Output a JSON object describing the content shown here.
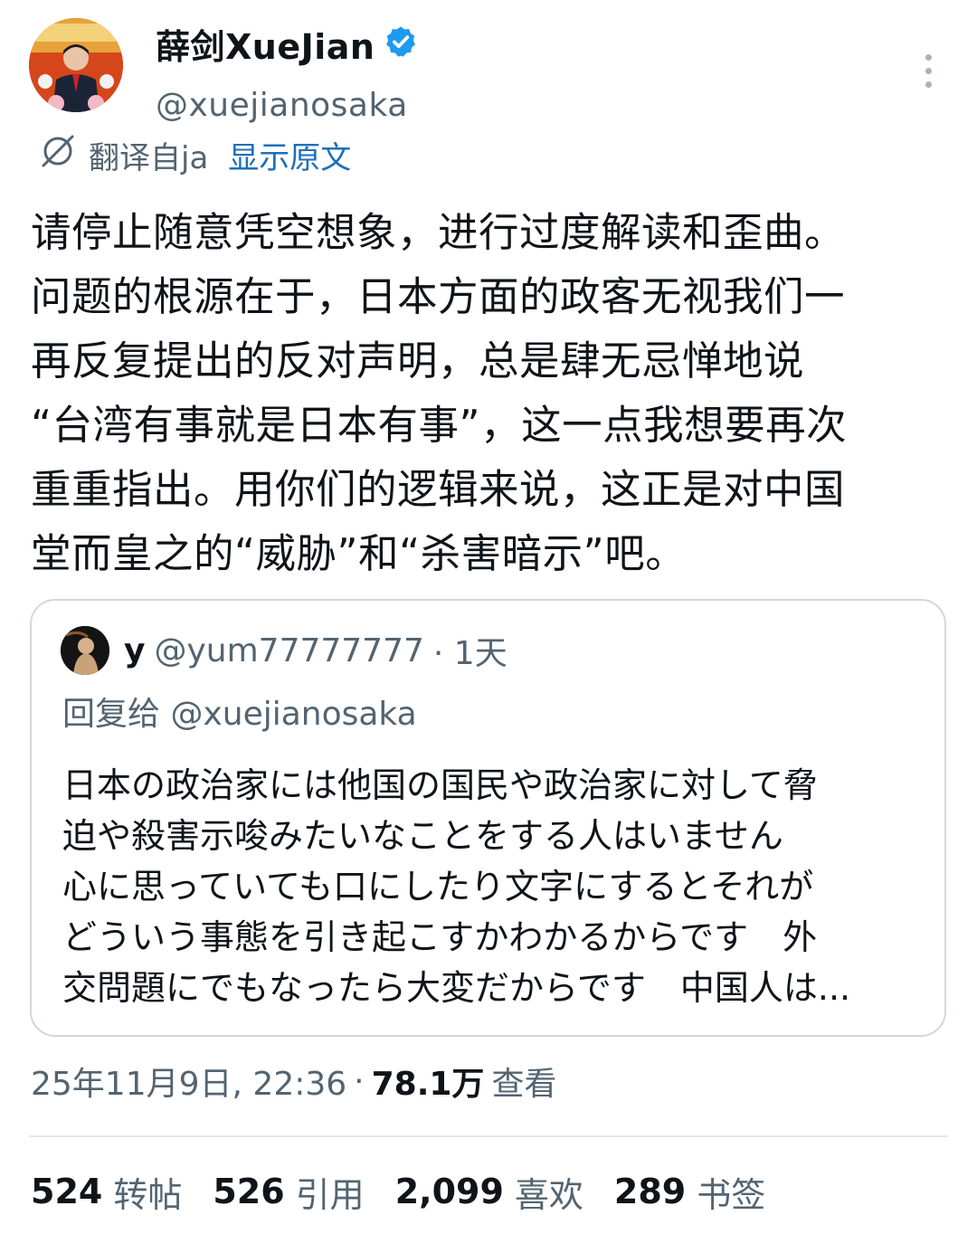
{
  "author": {
    "display_name": "薛剑XueJian",
    "handle": "@xuejianosaka",
    "verified_icon": "verified-badge-icon",
    "brand_color": "#1d9bf0"
  },
  "translation": {
    "label": "翻译自ja",
    "show_original": "显示原文"
  },
  "tweet": {
    "text": "请停止随意凭空想象，进行过度解读和歪曲。\n问题的根源在于，日本方面的政客无视我们一\n再反复提出的反对声明，总是肆无忌惮地说\n“台湾有事就是日本有事”，这一点我想要再次\n重重指出。用你们的逻辑来说，这正是对中国\n堂而皇之的“威胁”和“杀害暗示”吧。"
  },
  "quote": {
    "name": "y",
    "handle": "@yum77777777",
    "time": "· 1天",
    "reply_to": "回复给 @xuejianosaka",
    "text": "日本の政治家には他国の国民や政治家に対して脅\n迫や殺害示唆みたいなことをする人はいません\n心に思っていても口にしたり文字にするとそれが\nどういう事態を引き起こすかわかるからです　外\n交問題にでもなったら大変だからです　中国人は..."
  },
  "meta": {
    "timestamp": "25年11月9日, 22:36",
    "separator": "·",
    "views_count": "78.1万",
    "views_label": "查看"
  },
  "stats": {
    "reposts_count": "524",
    "reposts_label": "转帖",
    "quotes_count": "526",
    "quotes_label": "引用",
    "likes_count": "2,099",
    "likes_label": "喜欢",
    "bookmarks_count": "289",
    "bookmarks_label": "书签"
  }
}
